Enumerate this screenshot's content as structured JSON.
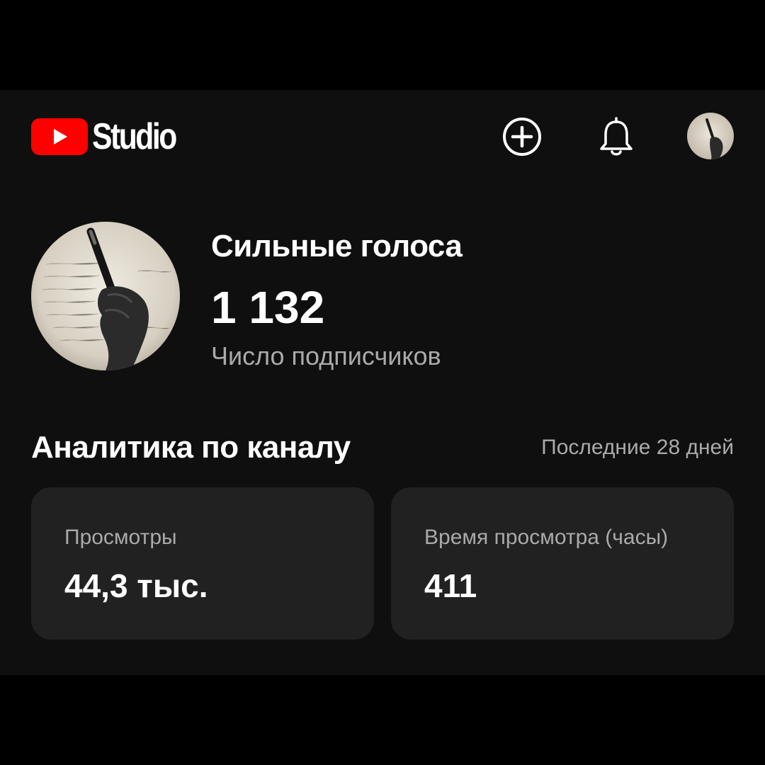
{
  "app": {
    "logo_text": "Studio",
    "brand_color": "#ff0000",
    "background_color": "#0f0f0f"
  },
  "header": {
    "icons": [
      "create-icon",
      "notifications-bell-icon",
      "account-avatar"
    ]
  },
  "channel": {
    "name": "Сильные голоса",
    "subscriber_count": "1 132",
    "subscriber_label": "Число подписчиков"
  },
  "analytics": {
    "title": "Аналитика по каналу",
    "period": "Последние 28 дней",
    "cards": [
      {
        "label": "Просмотры",
        "value": "44,3 тыс."
      },
      {
        "label": "Время просмотра (часы)",
        "value": "411"
      }
    ]
  }
}
